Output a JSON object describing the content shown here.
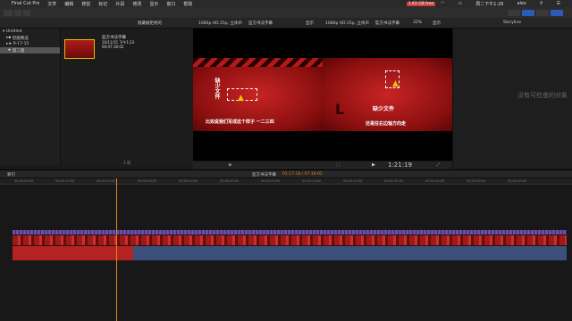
{
  "menubar": {
    "apple": "",
    "items": [
      "Final Cut Pro",
      "文件",
      "编辑",
      "修剪",
      "标记",
      "片段",
      "修改",
      "显示",
      "窗口",
      "帮助"
    ],
    "status_badge": "1.63 GB free",
    "clock": "周二下午1:26",
    "user": "alex"
  },
  "viewer_tools": {
    "event_filter": "隐藏被拒绝的",
    "format_left": "1080p HD 25p, 立体声",
    "clip_name_left": "监方书法字幕",
    "view_left": "显示",
    "format_right": "1080p HD 25p, 立体声",
    "clip_name_right": "監方书法字幕",
    "zoom": "32%",
    "view_right": "显示",
    "inspector_title": "Storyline"
  },
  "sidebar": {
    "items": [
      {
        "label": "Untitled",
        "selected": false
      },
      {
        "label": "智能精选",
        "selected": false
      },
      {
        "label": "9-17-15",
        "selected": false
      },
      {
        "label": "第二版",
        "selected": true
      }
    ]
  },
  "browser": {
    "clip_title": "监方书法字幕",
    "clip_date": "16/11/15 下午1:23",
    "clip_duration": "00:07:18:02",
    "count": "1 项"
  },
  "viewer": {
    "left_frame_caption": "比如说我们写成这个样子 一二三四",
    "left_frame_vertical": "缺少文件",
    "right_frame_title": "缺少文件",
    "right_frame_caption": "还是往右边轴方向走",
    "timecode": "1:21:19"
  },
  "inspector": {
    "empty_text": "没有可检查的对象"
  },
  "timeline": {
    "index_label": "索引",
    "project_name": "监方书法字幕",
    "position": "01:17:18 / 07:18:02",
    "ruler_ticks": [
      "00:00:00:00",
      "00:00:10:00",
      "00:00:20:00",
      "00:00:30:00",
      "00:00:40:00",
      "00:00:50:00",
      "00:01:00:00",
      "00:01:10:00",
      "00:01:20:00",
      "00:01:30:00",
      "00:01:40:00",
      "00:01:50:00",
      "00:02:00:00"
    ]
  },
  "colors": {
    "accent_blue": "#2f59b8",
    "clip_red": "#b11a1a",
    "audio_blue": "#3b4f7a",
    "fx_purple": "#6a4fa8",
    "playhead": "#e2871a",
    "timecode_orange": "#e2871a"
  }
}
